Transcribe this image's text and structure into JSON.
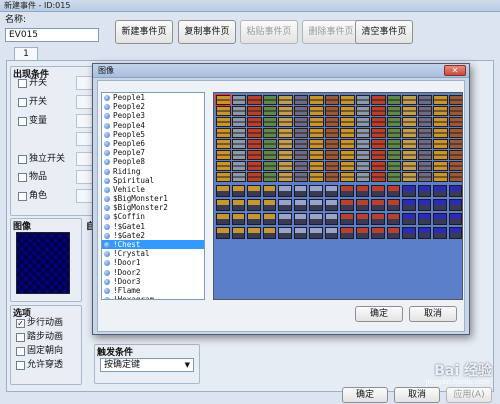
{
  "window": {
    "title": "新建事件 - ID:015"
  },
  "event": {
    "name_label": "名称:",
    "name_value": "EV015"
  },
  "toolbar": {
    "new_page": "新建事件页",
    "copy_page": "复制事件页",
    "paste_page": "粘贴事件页",
    "delete_page": "删除事件页",
    "clear_page": "清空事件页"
  },
  "tabs": [
    {
      "label": "1"
    }
  ],
  "conditions": {
    "title": "出现条件",
    "items": [
      {
        "label": "开关",
        "checked": false
      },
      {
        "label": "开关",
        "checked": false
      },
      {
        "label": "变量",
        "checked": false
      },
      {
        "label": "独立开关",
        "checked": false
      },
      {
        "label": "物品",
        "checked": false
      },
      {
        "label": "角色",
        "checked": false
      }
    ]
  },
  "image_section": {
    "title": "图像"
  },
  "move_section": {
    "title_fragment": "自"
  },
  "options": {
    "title": "选项",
    "items": [
      {
        "label": "步行动画",
        "checked": true
      },
      {
        "label": "踏步动画",
        "checked": false
      },
      {
        "label": "固定朝向",
        "checked": false
      },
      {
        "label": "允许穿透",
        "checked": false
      }
    ]
  },
  "trigger": {
    "title": "触发条件",
    "value": "按确定键"
  },
  "footer": {
    "ok": "确定",
    "cancel": "取消",
    "apply": "应用(A)"
  },
  "dialog": {
    "title": "图像",
    "files": [
      {
        "name": "People1",
        "selected": false
      },
      {
        "name": "People2",
        "selected": false
      },
      {
        "name": "People3",
        "selected": false
      },
      {
        "name": "People4",
        "selected": false
      },
      {
        "name": "People5",
        "selected": false
      },
      {
        "name": "People6",
        "selected": false
      },
      {
        "name": "People7",
        "selected": false
      },
      {
        "name": "People8",
        "selected": false
      },
      {
        "name": "Riding",
        "selected": false
      },
      {
        "name": "Spiritual",
        "selected": false
      },
      {
        "name": "Vehicle",
        "selected": false
      },
      {
        "name": "$BigMonster1",
        "selected": false
      },
      {
        "name": "$BigMonster2",
        "selected": false
      },
      {
        "name": "$Coffin",
        "selected": false
      },
      {
        "name": "!$Gate1",
        "selected": false
      },
      {
        "name": "!$Gate2",
        "selected": false
      },
      {
        "name": "!Chest",
        "selected": true
      },
      {
        "name": "!Crystal",
        "selected": false
      },
      {
        "name": "!Door1",
        "selected": false
      },
      {
        "name": "!Door2",
        "selected": false
      },
      {
        "name": "!Door3",
        "selected": false
      },
      {
        "name": "!Flame",
        "selected": false
      },
      {
        "name": "!Hexagram",
        "selected": false
      }
    ],
    "ok": "确定",
    "cancel": "取消"
  },
  "watermark": {
    "text": "Bai 经验",
    "sub": "jingyan.baidu.com"
  },
  "colors": {
    "preview_bg": "#5b7fc9",
    "selection": "#3399ff",
    "chest_gold": "#c8962e",
    "chest_dark": "#3a3a52",
    "chest_red": "#b8402c"
  }
}
